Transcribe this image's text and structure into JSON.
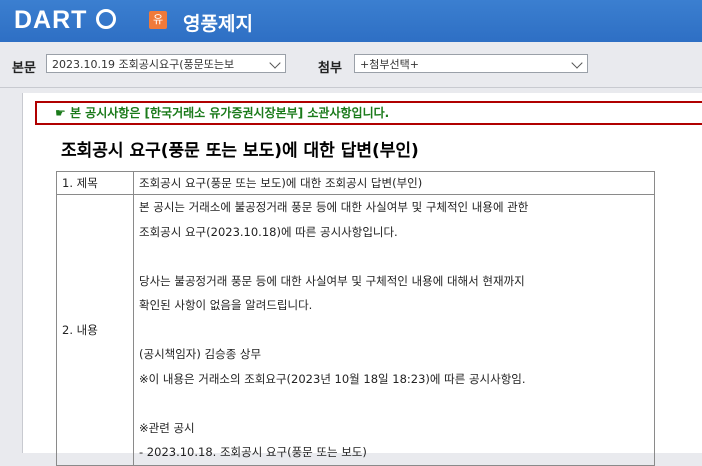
{
  "header": {
    "logo": "DART",
    "company_badge": "유",
    "company_name": "영풍제지"
  },
  "toolbar": {
    "body_label": "본문",
    "body_select_value": "2023.10.19  조회공시요구(풍문또는보",
    "attach_label": "첨부",
    "attach_select_value": "+첨부선택+"
  },
  "document": {
    "notice": "본 공시사항은 [한국거래소 유가증권시장본부] 소관사항입니다.",
    "title": "조회공시 요구(풍문 또는 보도)에 대한 답변(부인)",
    "rows": [
      {
        "label": "1. 제목",
        "lines": [
          "조회공시 요구(풍문 또는 보도)에 대한 조회공시 답변(부인)"
        ]
      },
      {
        "label": "2. 내용",
        "lines": [
          "본 공시는 거래소에 불공정거래 풍문 등에 대한 사실여부 및 구체적인 내용에 관한",
          "조회공시 요구(2023.10.18)에 따른 공시사항입니다.",
          "",
          "당사는 불공정거래 풍문 등에 대한 사실여부 및 구체적인 내용에 대해서 현재까지",
          "확인된 사항이 없음을 알려드립니다.",
          "",
          "(공시책임자) 김승종 상무",
          "※이 내용은 거래소의 조회요구(2023년 10월 18일 18:23)에 따른 공시사항임.",
          "",
          "※관련 공시",
          "- 2023.10.18. 조회공시 요구(풍문 또는 보도)"
        ]
      }
    ]
  }
}
